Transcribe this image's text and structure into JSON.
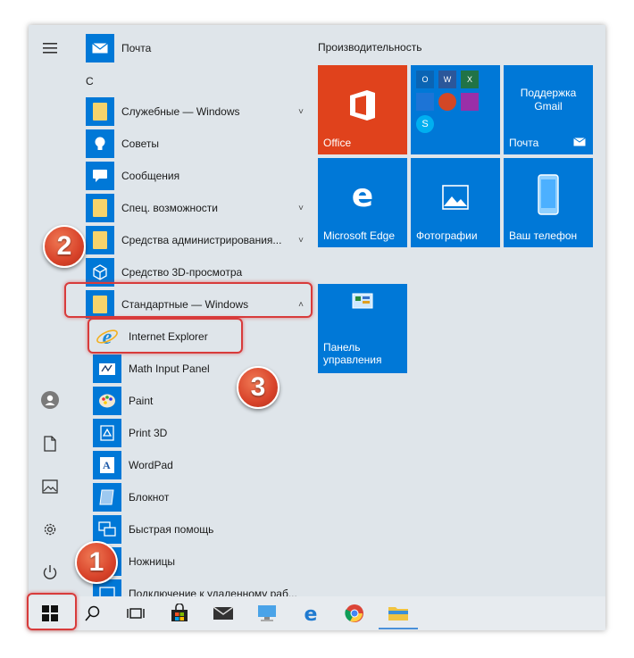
{
  "app_list": {
    "letter": "С",
    "items": [
      {
        "label": "Почта",
        "icon": "mail-icon",
        "type": "app"
      },
      {
        "label": "Служебные — Windows",
        "icon": "folder-icon",
        "type": "folder",
        "chevron": "˅"
      },
      {
        "label": "Советы",
        "icon": "lightbulb-icon",
        "type": "app"
      },
      {
        "label": "Сообщения",
        "icon": "message-icon",
        "type": "app"
      },
      {
        "label": "Спец. возможности",
        "icon": "folder-icon",
        "type": "folder",
        "chevron": "˅"
      },
      {
        "label": "Средства администрирования...",
        "icon": "folder-icon",
        "type": "folder",
        "chevron": "˅"
      },
      {
        "label": "Средство 3D-просмотра",
        "icon": "cube-icon",
        "type": "app"
      },
      {
        "label": "Стандартные — Windows",
        "icon": "folder-icon",
        "type": "folder",
        "chevron": "˄",
        "expanded": true
      }
    ],
    "sub_items": [
      {
        "label": "Internet Explorer",
        "icon": "internet-explorer-icon"
      },
      {
        "label": "Math Input Panel",
        "icon": "math-input-icon"
      },
      {
        "label": "Paint",
        "icon": "paint-icon"
      },
      {
        "label": "Print 3D",
        "icon": "print-3d-icon"
      },
      {
        "label": "WordPad",
        "icon": "wordpad-icon"
      },
      {
        "label": "Блокнот",
        "icon": "notepad-icon"
      },
      {
        "label": "Быстрая помощь",
        "icon": "quick-assist-icon"
      },
      {
        "label": "Ножницы",
        "icon": "scissors-icon"
      },
      {
        "label": "Подключение к удаленному раб...",
        "icon": "remote-desktop-icon"
      }
    ]
  },
  "tiles": {
    "group_title": "Производительность",
    "items": [
      {
        "label": "Office",
        "color": "#e0421c",
        "icon": "office-icon"
      },
      {
        "label": "",
        "color": "#0078d7",
        "icon": "office-apps-folder-icon"
      },
      {
        "label": "Поддержка Gmail",
        "sub": "Почта",
        "color": "#0078d7",
        "icon": "mail-icon"
      },
      {
        "label": "Microsoft Edge",
        "color": "#0078d7",
        "icon": "edge-icon"
      },
      {
        "label": "Фотографии",
        "color": "#0078d7",
        "icon": "photos-icon"
      },
      {
        "label": "Ваш телефон",
        "color": "#0078d7",
        "icon": "phone-icon"
      },
      {
        "label": "Панель управления",
        "color": "#0078d7",
        "icon": "control-panel-icon"
      }
    ]
  },
  "annotations": [
    "1",
    "2",
    "3"
  ],
  "colors": {
    "tile_blue": "#0078d7",
    "office_red": "#e0421c",
    "highlight": "#d83b3b"
  }
}
